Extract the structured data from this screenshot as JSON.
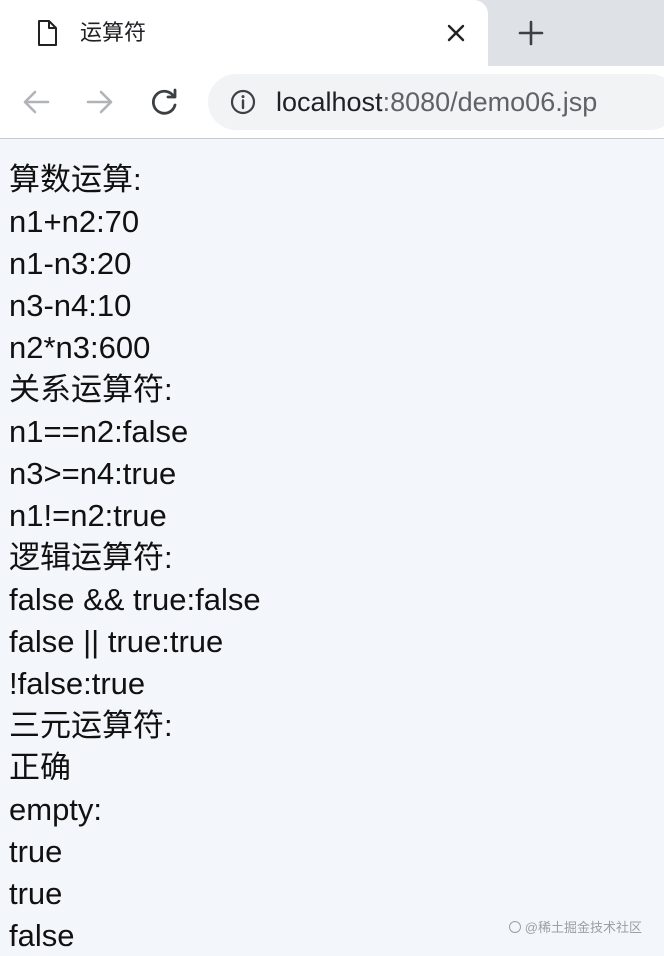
{
  "tab": {
    "title": "运算符",
    "icon": "page-icon",
    "close_icon": "close-icon"
  },
  "new_tab": {
    "icon": "plus-icon"
  },
  "toolbar": {
    "back_icon": "arrow-left-icon",
    "forward_icon": "arrow-right-icon",
    "reload_icon": "reload-icon",
    "info_icon": "info-icon",
    "url_host": "localhost",
    "url_rest": ":8080/demo06.jsp"
  },
  "content": {
    "lines": [
      "算数运算:",
      "n1+n2:70",
      "n1-n3:20",
      "n3-n4:10",
      "n2*n3:600",
      "关系运算符:",
      "n1==n2:false",
      "n3>=n4:true",
      "n1!=n2:true",
      "逻辑运算符:",
      "false && true:false",
      "false || true:true",
      "!false:true",
      "三元运算符:",
      "正确",
      "empty:",
      "true",
      "true",
      "false"
    ]
  },
  "watermark": {
    "text": "@稀土掘金技术社区"
  },
  "colors": {
    "tab_strip": "#dee1e6",
    "page_background": "#f3f6fa",
    "omnibox": "#f1f3f4",
    "text": "#111111"
  }
}
